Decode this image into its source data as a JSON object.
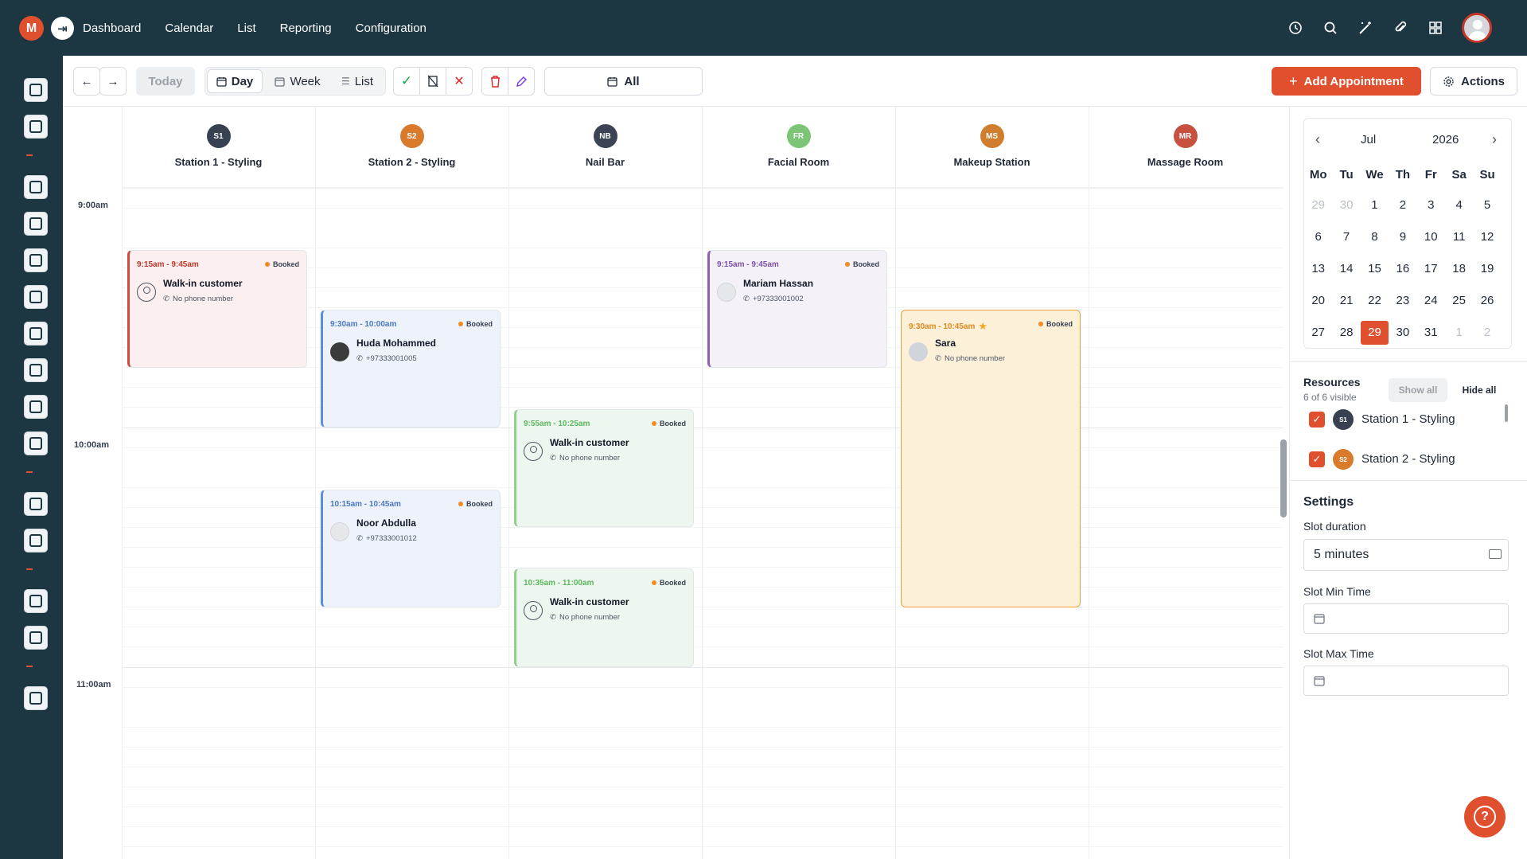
{
  "topbar": {
    "logo_text": "M",
    "nav": [
      "Dashboard",
      "Calendar",
      "List",
      "Reporting",
      "Configuration"
    ],
    "icons": [
      "history-icon",
      "search-icon",
      "magic-wand-icon",
      "paperclip-icon",
      "apps-grid-icon"
    ]
  },
  "toolbar": {
    "today_label": "Today",
    "day_label": "Day",
    "week_label": "Week",
    "list_label": "List",
    "filter_label": "All",
    "add_label": "Add Appointment",
    "actions_label": "Actions",
    "accent": "#e0502f"
  },
  "times": [
    "9:00am",
    "10:00am",
    "11:00am"
  ],
  "resources": [
    {
      "code": "S1",
      "name": "Station 1 - Styling",
      "color": "#374151"
    },
    {
      "code": "S2",
      "name": "Station 2 - Styling",
      "color": "#d97b2b"
    },
    {
      "code": "NB",
      "name": "Nail Bar",
      "color": "#3b4454"
    },
    {
      "code": "FR",
      "name": "Facial Room",
      "color": "#7cc576"
    },
    {
      "code": "MS",
      "name": "Makeup Station",
      "color": "#d07d2e"
    },
    {
      "code": "MR",
      "name": "Massage Room",
      "color": "#c7503f"
    }
  ],
  "appointments": [
    {
      "time": "9:15am - 9:45am",
      "status": "Booked",
      "name": "Walk-in customer",
      "phone": "No phone number"
    },
    {
      "time": "9:30am - 10:00am",
      "status": "Booked",
      "name": "Huda Mohammed",
      "phone": "+97333001005"
    },
    {
      "time": "10:15am - 10:45am",
      "status": "Booked",
      "name": "Noor Abdulla",
      "phone": "+97333001012"
    },
    {
      "time": "9:55am - 10:25am",
      "status": "Booked",
      "name": "Walk-in customer",
      "phone": "No phone number"
    },
    {
      "time": "10:35am - 11:00am",
      "status": "Booked",
      "name": "Walk-in customer",
      "phone": "No phone number"
    },
    {
      "time": "9:15am - 9:45am",
      "status": "Booked",
      "name": "Mariam Hassan",
      "phone": "+97333001002"
    },
    {
      "time": "9:30am - 10:45am",
      "status": "Booked",
      "name": "Sara",
      "phone": "No phone number"
    }
  ],
  "minical": {
    "month": "Jul",
    "year": "2026",
    "dow": [
      "Mo",
      "Tu",
      "We",
      "Th",
      "Fr",
      "Sa",
      "Su"
    ],
    "weeks": [
      [
        "29",
        "30",
        "1",
        "2",
        "3",
        "4",
        "5"
      ],
      [
        "6",
        "7",
        "8",
        "9",
        "10",
        "11",
        "12"
      ],
      [
        "13",
        "14",
        "15",
        "16",
        "17",
        "18",
        "19"
      ],
      [
        "20",
        "21",
        "22",
        "23",
        "24",
        "25",
        "26"
      ],
      [
        "27",
        "28",
        "29",
        "30",
        "31",
        "1",
        "2"
      ]
    ],
    "selected": "29"
  },
  "resources_panel": {
    "title": "Resources",
    "subtitle": "6 of 6 visible",
    "show_all": "Show all",
    "hide_all": "Hide all",
    "items": [
      {
        "code": "S1",
        "name": "Station 1 - Styling"
      },
      {
        "code": "S2",
        "name": "Station 2 - Styling"
      }
    ]
  },
  "settings": {
    "title": "Settings",
    "slot_duration_label": "Slot duration",
    "slot_duration_value": "5 minutes",
    "slot_min_label": "Slot Min Time",
    "slot_max_label": "Slot Max Time"
  }
}
